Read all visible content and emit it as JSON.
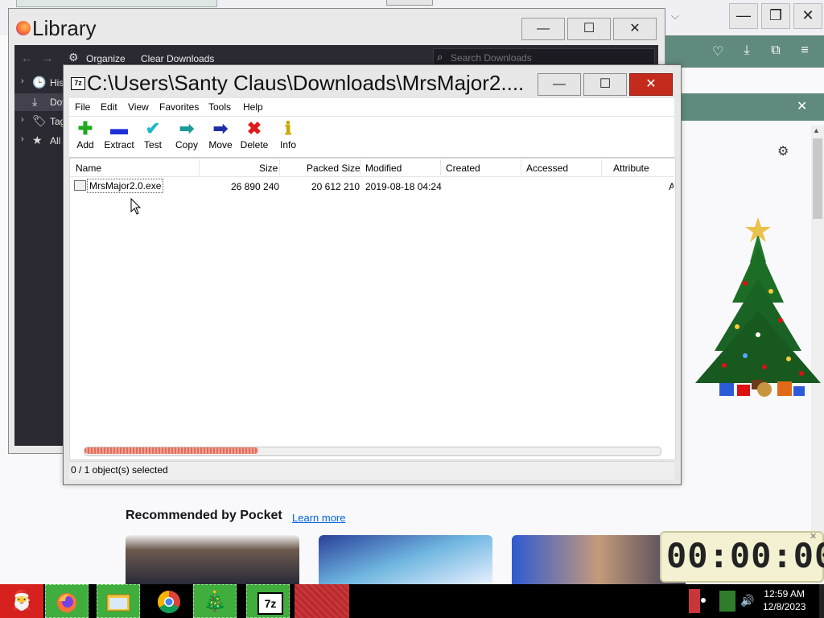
{
  "firefox": {
    "notif_close": "✕",
    "settings_icon": "⚙",
    "toolbar_icons": [
      "pocket-icon",
      "download-icon",
      "extensions-icon",
      "menu-icon"
    ],
    "pocket": {
      "title": "Recommended by Pocket",
      "learn_more": "Learn more"
    }
  },
  "library": {
    "title": "Library",
    "toolbar": {
      "organize": "Organize",
      "clear_downloads": "Clear Downloads",
      "search_placeholder": "Search Downloads"
    },
    "sidebar": [
      {
        "label": "History",
        "icon": "clock-icon",
        "glyph": "🕒",
        "chev": "›"
      },
      {
        "label": "Downloads",
        "icon": "download-icon",
        "glyph": "⤓",
        "chev": ""
      },
      {
        "label": "Tags",
        "icon": "tag-icon",
        "glyph": "🏷",
        "chev": "›"
      },
      {
        "label": "All Bookmarks",
        "icon": "star-icon",
        "glyph": "★",
        "chev": "›"
      }
    ]
  },
  "sevenzip": {
    "title": "C:\\Users\\Santy Claus\\Downloads\\MrsMajor2....",
    "menu": [
      "File",
      "Edit",
      "View",
      "Favorites",
      "Tools",
      "Help"
    ],
    "toolbar": [
      {
        "label": "Add",
        "glyph": "✚",
        "color": "#1faa1f"
      },
      {
        "label": "Extract",
        "glyph": "▬",
        "color": "#1d2fd6"
      },
      {
        "label": "Test",
        "glyph": "✔",
        "color": "#1fb8c9"
      },
      {
        "label": "Copy",
        "glyph": "➡",
        "color": "#1a9a9a"
      },
      {
        "label": "Move",
        "glyph": "➡",
        "color": "#1d2fa6"
      },
      {
        "label": "Delete",
        "glyph": "✖",
        "color": "#e0191b"
      },
      {
        "label": "Info",
        "glyph": "ℹ",
        "color": "#c8a800"
      }
    ],
    "columns": [
      "Name",
      "Size",
      "Packed Size",
      "Modified",
      "Created",
      "Accessed",
      "Attribute"
    ],
    "rows": [
      {
        "name": "MrsMajor2.0.exe",
        "size": "26 890 240",
        "packed": "20 612 210",
        "modified": "2019-08-18 04:24",
        "created": "",
        "accessed": "",
        "attr": "A"
      }
    ],
    "status": "0 / 1 object(s) selected"
  },
  "stopwatch": {
    "display": "00:00:00"
  },
  "taskbar": {
    "time": "12:59 AM",
    "date": "12/8/2023",
    "apps": [
      "santa-icon",
      "firefox-icon",
      "file-explorer-icon",
      "chrome-icon",
      "christmas-tree-icon",
      "7zip-icon"
    ]
  }
}
